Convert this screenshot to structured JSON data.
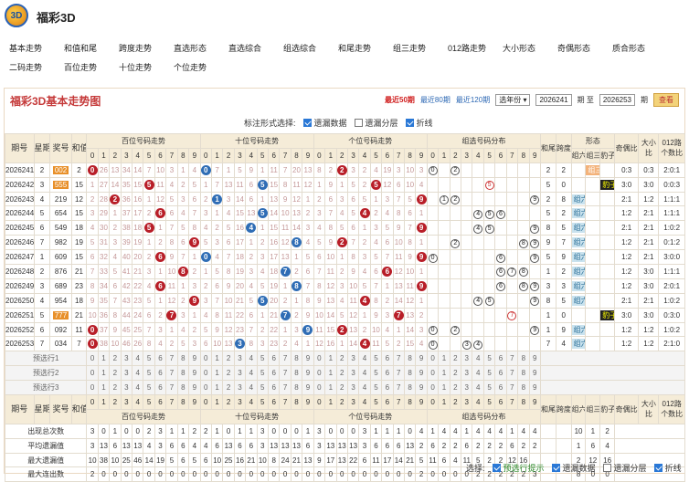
{
  "app": {
    "title": "福彩3D",
    "logo_text": "3D"
  },
  "nav": {
    "row1": [
      "基本走势",
      "和值和尾",
      "跨度走势",
      "直选形态",
      "直选综合",
      "组选综合",
      "和尾走势",
      "组三走势",
      "012路走势",
      "大小形态",
      "奇偶形态",
      "质合形态"
    ],
    "row2": [
      "二码走势",
      "百位走势",
      "十位走势",
      "个位走势"
    ]
  },
  "panel": {
    "title": "福彩3D基本走势图",
    "ranges": {
      "r50": "最近50期",
      "r80": "最近80期",
      "r120": "最近120期",
      "select": "选年份",
      "from": "2026241",
      "mid": "期 至",
      "to": "2026253",
      "end": "期",
      "go": "查看"
    },
    "options": {
      "label": "标注形式选择:",
      "o1": "遗漏数据",
      "o2": "遗漏分层",
      "o3": "折线"
    }
  },
  "table": {
    "h_issue": "期号",
    "h_week": "星期",
    "h_num": "奖号",
    "h_sum": "和值",
    "h_bai": "百位号码走势",
    "h_shi": "十位号码走势",
    "h_ge": "个位号码走势",
    "h_zu": "组选号码分布",
    "h_hw": "和尾",
    "h_kd": "跨度",
    "h_xt": "形态",
    "h_z6": "组六",
    "h_z3": "组三",
    "h_bz": "豹子",
    "h_jo": "奇偶比",
    "h_dx": "大小比",
    "h_012": "012路个数比",
    "digits": [
      "0",
      "1",
      "2",
      "3",
      "4",
      "5",
      "6",
      "7",
      "8",
      "9"
    ],
    "rows": [
      {
        "issue": "2026241",
        "week": "2",
        "num": "002",
        "sum": "2",
        "b": 0,
        "s": 0,
        "g": 2,
        "bm": [
          "",
          "26",
          "13",
          "34",
          "14",
          "7",
          "10",
          "3",
          "1",
          "4"
        ],
        "sm": [
          "",
          "7",
          "1",
          "5",
          "9",
          "1",
          "11",
          "7",
          "20",
          "13"
        ],
        "gm": [
          "8",
          "2",
          "",
          "3",
          "2",
          "4",
          "19",
          "3",
          "10",
          "3"
        ],
        "zu": "0 2",
        "hw": "2",
        "kd": "2",
        "xt": "z3",
        "jo": "0:3",
        "dx": "0:3",
        "lu": "2:0:1"
      },
      {
        "issue": "2026242",
        "week": "3",
        "num": "555",
        "sum": "15",
        "b": 5,
        "s": 5,
        "g": 5,
        "bm": [
          "1",
          "27",
          "14",
          "35",
          "15",
          "",
          "11",
          "4",
          "2",
          "5"
        ],
        "sm": [
          "1",
          "7",
          "13",
          "11",
          "6",
          "",
          "15",
          "8",
          "11",
          "12"
        ],
        "gm": [
          "1",
          "9",
          "1",
          "5",
          "2",
          "",
          "12",
          "6",
          "10",
          "4"
        ],
        "zu": "5",
        "hw": "5",
        "kd": "0",
        "xt": "bz",
        "jo": "3:0",
        "dx": "3:0",
        "lu": "0:0:3"
      },
      {
        "issue": "2026243",
        "week": "4",
        "num": "219",
        "sum": "12",
        "b": 2,
        "s": 1,
        "g": 9,
        "bm": [
          "2",
          "28",
          "",
          "36",
          "16",
          "1",
          "12",
          "5",
          "3",
          "6"
        ],
        "sm": [
          "2",
          "",
          "3",
          "14",
          "6",
          "1",
          "13",
          "9",
          "12",
          "1"
        ],
        "gm": [
          "2",
          "6",
          "3",
          "6",
          "5",
          "1",
          "3",
          "7",
          "5",
          ""
        ],
        "zu": "1 2 9",
        "hw": "2",
        "kd": "8",
        "xt": "z6",
        "jo": "2:1",
        "dx": "1:2",
        "lu": "1:1:1"
      },
      {
        "issue": "2026244",
        "week": "5",
        "num": "654",
        "sum": "15",
        "b": 6,
        "s": 5,
        "g": 4,
        "bm": [
          "3",
          "29",
          "1",
          "37",
          "17",
          "2",
          "",
          "6",
          "4",
          "7"
        ],
        "sm": [
          "3",
          "1",
          "4",
          "15",
          "13",
          "",
          "14",
          "10",
          "13",
          "2"
        ],
        "gm": [
          "3",
          "7",
          "4",
          "5",
          "",
          "2",
          "4",
          "8",
          "6",
          "1"
        ],
        "zu": "4 5 6",
        "hw": "5",
        "kd": "2",
        "xt": "z6",
        "jo": "1:2",
        "dx": "2:1",
        "lu": "1:1:1"
      },
      {
        "issue": "2026245",
        "week": "6",
        "num": "549",
        "sum": "18",
        "b": 5,
        "s": 4,
        "g": 9,
        "bm": [
          "4",
          "30",
          "2",
          "38",
          "18",
          "",
          "1",
          "7",
          "5",
          "8"
        ],
        "sm": [
          "4",
          "2",
          "5",
          "16",
          "",
          "1",
          "15",
          "11",
          "14",
          "3"
        ],
        "gm": [
          "4",
          "8",
          "5",
          "6",
          "1",
          "3",
          "5",
          "9",
          "7",
          ""
        ],
        "zu": "4 5 9",
        "hw": "8",
        "kd": "5",
        "xt": "z6",
        "jo": "2:1",
        "dx": "2:1",
        "lu": "1:0:2"
      },
      {
        "issue": "2026246",
        "week": "7",
        "num": "982",
        "sum": "19",
        "b": 9,
        "s": 8,
        "g": 2,
        "bm": [
          "5",
          "31",
          "3",
          "39",
          "19",
          "1",
          "2",
          "8",
          "6",
          ""
        ],
        "sm": [
          "5",
          "3",
          "6",
          "17",
          "1",
          "2",
          "16",
          "12",
          "",
          "4"
        ],
        "gm": [
          "5",
          "9",
          "",
          "7",
          "2",
          "4",
          "6",
          "10",
          "8",
          "1"
        ],
        "zu": "2 8 9",
        "hw": "9",
        "kd": "7",
        "xt": "z6",
        "jo": "1:2",
        "dx": "2:1",
        "lu": "0:1:2"
      },
      {
        "issue": "2026247",
        "week": "1",
        "num": "609",
        "sum": "15",
        "b": 6,
        "s": 0,
        "g": 9,
        "bm": [
          "6",
          "32",
          "4",
          "40",
          "20",
          "2",
          "",
          "9",
          "7",
          "1"
        ],
        "sm": [
          "",
          "4",
          "7",
          "18",
          "2",
          "3",
          "17",
          "13",
          "1",
          "5"
        ],
        "gm": [
          "6",
          "10",
          "1",
          "8",
          "3",
          "5",
          "7",
          "11",
          "9",
          ""
        ],
        "zu": "0 6 9",
        "hw": "5",
        "kd": "9",
        "xt": "z6",
        "jo": "1:2",
        "dx": "2:1",
        "lu": "3:0:0"
      },
      {
        "issue": "2026248",
        "week": "2",
        "num": "876",
        "sum": "21",
        "b": 8,
        "s": 7,
        "g": 6,
        "bm": [
          "7",
          "33",
          "5",
          "41",
          "21",
          "3",
          "1",
          "10",
          "",
          "2"
        ],
        "sm": [
          "1",
          "5",
          "8",
          "19",
          "3",
          "4",
          "18",
          "",
          "2",
          "6"
        ],
        "gm": [
          "7",
          "11",
          "2",
          "9",
          "4",
          "6",
          "",
          "12",
          "10",
          "1"
        ],
        "zu": "6 7 8",
        "hw": "1",
        "kd": "2",
        "xt": "z6",
        "jo": "1:2",
        "dx": "3:0",
        "lu": "1:1:1"
      },
      {
        "issue": "2026249",
        "week": "3",
        "num": "689",
        "sum": "23",
        "b": 6,
        "s": 8,
        "g": 9,
        "bm": [
          "8",
          "34",
          "6",
          "42",
          "22",
          "4",
          "",
          "11",
          "1",
          "3"
        ],
        "sm": [
          "2",
          "6",
          "9",
          "20",
          "4",
          "5",
          "19",
          "1",
          "",
          "7"
        ],
        "gm": [
          "8",
          "12",
          "3",
          "10",
          "5",
          "7",
          "1",
          "13",
          "11",
          ""
        ],
        "zu": "6 8 9",
        "hw": "3",
        "kd": "3",
        "xt": "z6",
        "jo": "1:2",
        "dx": "3:0",
        "lu": "2:0:1"
      },
      {
        "issue": "2026250",
        "week": "4",
        "num": "954",
        "sum": "18",
        "b": 9,
        "s": 5,
        "g": 4,
        "bm": [
          "9",
          "35",
          "7",
          "43",
          "23",
          "5",
          "1",
          "12",
          "2",
          ""
        ],
        "sm": [
          "3",
          "7",
          "10",
          "21",
          "5",
          "",
          "20",
          "2",
          "1",
          "8"
        ],
        "gm": [
          "9",
          "13",
          "4",
          "11",
          "",
          "8",
          "2",
          "14",
          "12",
          "1"
        ],
        "zu": "4 5 9",
        "hw": "8",
        "kd": "5",
        "xt": "z6",
        "jo": "2:1",
        "dx": "2:1",
        "lu": "1:0:2"
      },
      {
        "issue": "2026251",
        "week": "5",
        "num": "777",
        "sum": "21",
        "b": 7,
        "s": 7,
        "g": 7,
        "bm": [
          "10",
          "36",
          "8",
          "44",
          "24",
          "6",
          "2",
          "",
          "3",
          "1"
        ],
        "sm": [
          "4",
          "8",
          "11",
          "22",
          "6",
          "1",
          "21",
          "",
          "2",
          "9"
        ],
        "gm": [
          "10",
          "14",
          "5",
          "12",
          "1",
          "9",
          "3",
          "",
          "13",
          "2"
        ],
        "zu": "7",
        "hw": "1",
        "kd": "0",
        "xt": "bz",
        "jo": "3:0",
        "dx": "3:0",
        "lu": "0:3:0"
      },
      {
        "issue": "2026252",
        "week": "6",
        "num": "092",
        "sum": "11",
        "b": 0,
        "s": 9,
        "g": 2,
        "bm": [
          "",
          "37",
          "9",
          "45",
          "25",
          "7",
          "3",
          "1",
          "4",
          "2"
        ],
        "sm": [
          "5",
          "9",
          "12",
          "23",
          "7",
          "2",
          "22",
          "1",
          "3",
          ""
        ],
        "gm": [
          "11",
          "15",
          "",
          "13",
          "2",
          "10",
          "4",
          "1",
          "14",
          "3"
        ],
        "zu": "0 2 9",
        "hw": "1",
        "kd": "9",
        "xt": "z6",
        "jo": "1:2",
        "dx": "1:2",
        "lu": "1:0:2"
      },
      {
        "issue": "2026253",
        "week": "7",
        "num": "034",
        "sum": "7",
        "b": 0,
        "s": 3,
        "g": 4,
        "bm": [
          "",
          "38",
          "10",
          "46",
          "26",
          "8",
          "4",
          "2",
          "5",
          "3"
        ],
        "sm": [
          "6",
          "10",
          "13",
          "",
          "8",
          "3",
          "23",
          "2",
          "4",
          "1"
        ],
        "gm": [
          "12",
          "16",
          "1",
          "14",
          "",
          "11",
          "5",
          "2",
          "15",
          "4"
        ],
        "zu": "0 3 4",
        "hw": "7",
        "kd": "4",
        "xt": "z6",
        "jo": "1:2",
        "dx": "1:2",
        "lu": "2:1:0"
      }
    ],
    "preview": [
      "预选行1",
      "预选行2",
      "预选行3"
    ],
    "stats": [
      {
        "label": "出现总次数",
        "v": [
          "3",
          "0",
          "1",
          "0",
          "0",
          "2",
          "3",
          "1",
          "1",
          "2",
          "2",
          "1",
          "0",
          "1",
          "1",
          "3",
          "0",
          "0",
          "0",
          "1",
          "3",
          "0",
          "0",
          "0",
          "3",
          "1",
          "1",
          "1",
          "0",
          "4",
          "1",
          "4",
          "4",
          "1",
          "4",
          "4",
          "4",
          "1",
          "4",
          "4"
        ],
        "z6": "10",
        "z3": "1",
        "bz": "2"
      },
      {
        "label": "平均遗漏值",
        "v": [
          "3",
          "13",
          "6",
          "13",
          "13",
          "4",
          "3",
          "6",
          "6",
          "4",
          "4",
          "6",
          "13",
          "6",
          "6",
          "3",
          "13",
          "13",
          "13",
          "6",
          "3",
          "13",
          "13",
          "13",
          "3",
          "6",
          "6",
          "6",
          "13",
          "2",
          "6",
          "2",
          "2",
          "6",
          "2",
          "2",
          "2",
          "6",
          "2",
          "2"
        ],
        "z6": "1",
        "z3": "6",
        "bz": "4"
      },
      {
        "label": "最大遗漏值",
        "v": [
          "10",
          "38",
          "10",
          "25",
          "46",
          "14",
          "19",
          "5",
          "6",
          "5",
          "6",
          "10",
          "25",
          "16",
          "21",
          "10",
          "8",
          "24",
          "21",
          "13",
          "9",
          "17",
          "13",
          "22",
          "6",
          "11",
          "17",
          "14",
          "21",
          "5",
          "11",
          "6",
          "4",
          "11",
          "5",
          "2",
          "2",
          "12",
          "16"
        ],
        "z6": "2",
        "z3": "12",
        "bz": "16"
      },
      {
        "label": "最大连出数",
        "v": [
          "2",
          "0",
          "0",
          "0",
          "0",
          "0",
          "0",
          "0",
          "0",
          "0",
          "0",
          "0",
          "0",
          "0",
          "0",
          "0",
          "0",
          "0",
          "0",
          "0",
          "0",
          "0",
          "0",
          "0",
          "0",
          "0",
          "0",
          "0",
          "0",
          "2",
          "0",
          "0",
          "0",
          "0",
          "2",
          "2",
          "2",
          "2",
          "2",
          "3"
        ],
        "z6": "8",
        "z3": "0",
        "bz": "0"
      }
    ]
  },
  "footer": {
    "label": "选择:",
    "f1": "预选行提示",
    "f2": "遗漏数据",
    "f3": "遗漏分层",
    "f4": "折线"
  }
}
